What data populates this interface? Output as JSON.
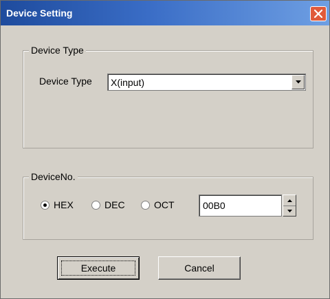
{
  "window": {
    "title": "Device Setting",
    "close_icon": "close-icon"
  },
  "device_type_group": {
    "legend": "Device Type",
    "field_label": "Device Type",
    "select_value": "X(input)"
  },
  "device_no_group": {
    "legend": "DeviceNo.",
    "radios": [
      {
        "label": "HEX",
        "checked": true
      },
      {
        "label": "DEC",
        "checked": false
      },
      {
        "label": "OCT",
        "checked": false
      }
    ],
    "value": "00B0"
  },
  "buttons": {
    "execute": "Execute",
    "cancel": "Cancel"
  },
  "colors": {
    "title_start": "#1e4b9d",
    "title_end": "#6e9fe3",
    "close": "#e05a3a",
    "face": "#d4d0c8"
  }
}
